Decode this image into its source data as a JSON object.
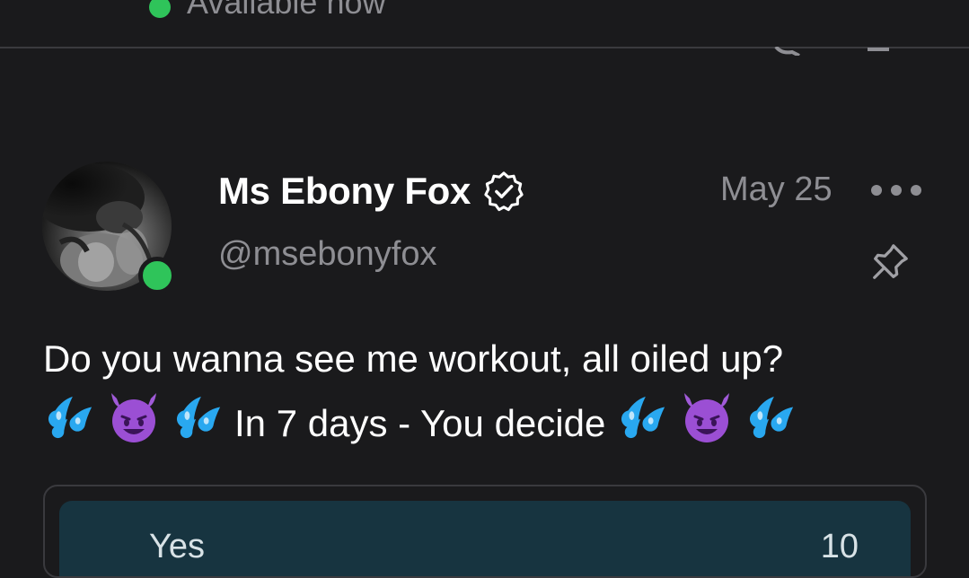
{
  "status": {
    "availability_text": "Available now",
    "status_color": "#2fc45a"
  },
  "post": {
    "author": {
      "display_name": "Ms Ebony Fox",
      "handle": "@msebonyfox",
      "verified": true,
      "online": true
    },
    "date": "May 25",
    "pinned": true,
    "text_line1": "Do you wanna see me workout, all oiled up?",
    "text_line2": "In 7 days - You decide",
    "emojis": [
      "sweat-droplets",
      "smiling-devil",
      "sweat-droplets"
    ],
    "poll": {
      "options": [
        {
          "label": "Yes",
          "count": "10"
        }
      ]
    }
  },
  "colors": {
    "background": "#1a1a1c",
    "muted_text": "#8e8e93",
    "poll_fill": "#173440",
    "online_green": "#2fc45a"
  }
}
